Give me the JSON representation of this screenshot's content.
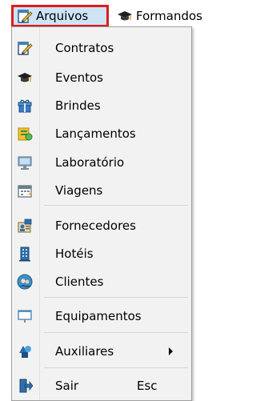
{
  "menubar": {
    "arquivos": {
      "label": "Arquivos",
      "icon": "edit-document-icon"
    },
    "formandos": {
      "label": "Formandos",
      "icon": "graduation-cap-icon"
    }
  },
  "menu": {
    "items": [
      {
        "label": "Contratos",
        "icon": "edit-document-icon"
      },
      {
        "label": "Eventos",
        "icon": "graduation-cap-icon"
      },
      {
        "label": "Brindes",
        "icon": "gift-icon"
      },
      {
        "label": "Lançamentos",
        "icon": "ledger-icon"
      },
      {
        "label": "Laboratório",
        "icon": "monitor-icon"
      },
      {
        "label": "Viagens",
        "icon": "calendar-icon"
      },
      {
        "label": "Fornecedores",
        "icon": "supplier-card-icon"
      },
      {
        "label": "Hotéis",
        "icon": "building-icon"
      },
      {
        "label": "Clientes",
        "icon": "clients-icon"
      },
      {
        "label": "Equipamentos",
        "icon": "screen-icon"
      },
      {
        "label": "Auxiliares",
        "icon": "shapes-icon",
        "submenu": true
      },
      {
        "label": "Sair",
        "icon": "exit-icon",
        "shortcut": "Esc"
      }
    ]
  },
  "colors": {
    "highlight_border": "#e01b1b",
    "highlight_bg": "#cde4f7",
    "menu_bg": "#f2f2f2"
  }
}
